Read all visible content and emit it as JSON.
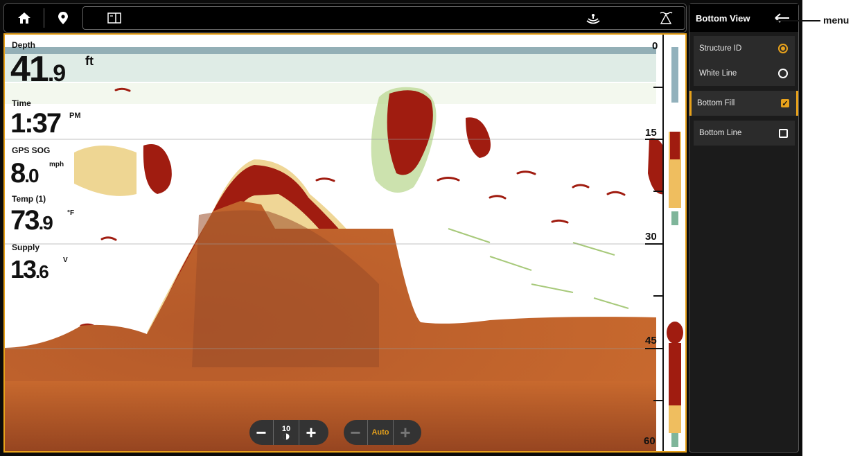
{
  "topbar": {
    "home_icon": "home-icon",
    "waypoint_icon": "map-pin-icon",
    "view_icon": "split-view-icon",
    "sonar_icon": "sonar-signal-icon",
    "transducer_icon": "transducer-icon"
  },
  "readouts": [
    {
      "label": "Depth",
      "value": "41",
      "decimal": ".9",
      "unit": "ft"
    },
    {
      "label": "Time",
      "value": "1:37",
      "decimal": "",
      "unit": "PM"
    },
    {
      "label": "GPS SOG",
      "value": "8",
      "decimal": ".0",
      "unit": "mph"
    },
    {
      "label": "Temp (1)",
      "value": "73",
      "decimal": ".9",
      "unit": "°F"
    },
    {
      "label": "Supply",
      "value": "13",
      "decimal": ".6",
      "unit": "V"
    }
  ],
  "depth_scale": [
    "0",
    "15",
    "30",
    "45",
    "60"
  ],
  "controls": {
    "sensitivity_value": "10",
    "range_value": "Auto",
    "minus": "−",
    "plus": "+"
  },
  "menu": {
    "title": "Bottom View",
    "back_icon": "back-arrow-icon",
    "items": [
      {
        "label": "Structure ID",
        "control": "radio",
        "state": "on"
      },
      {
        "label": "White Line",
        "control": "radio",
        "state": "off"
      },
      {
        "label": "Bottom Fill",
        "control": "checkbox",
        "state": "on"
      },
      {
        "label": "Bottom Line",
        "control": "checkbox",
        "state": "off"
      }
    ]
  },
  "callout": {
    "text": "menu"
  },
  "colors": {
    "accent": "#e8a21b",
    "bottom": "#c9692c",
    "strong_return": "#a01c10"
  }
}
